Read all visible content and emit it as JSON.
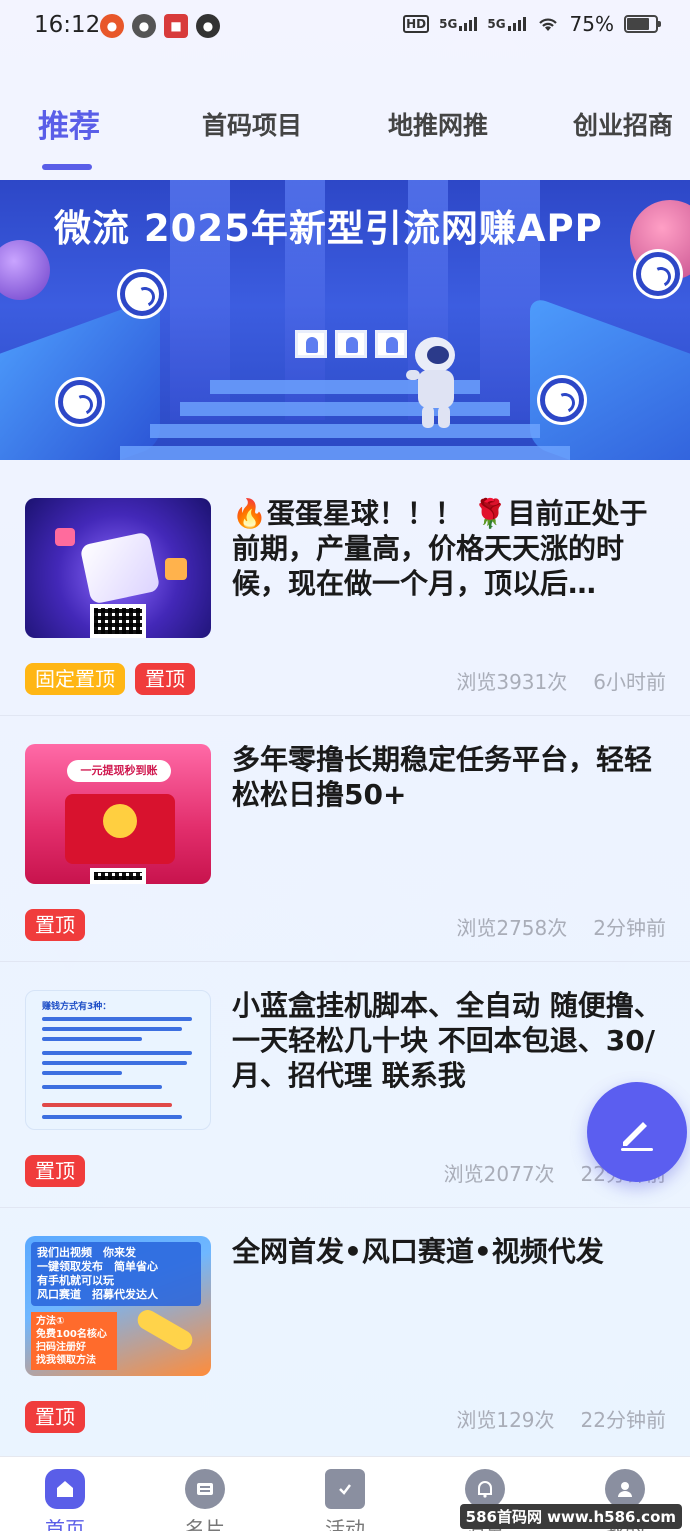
{
  "status_bar": {
    "time": "16:12",
    "battery_percent": "75%",
    "hd_label": "HD",
    "net1": "5G",
    "net2": "5G",
    "battery_level": 0.75
  },
  "tabs": [
    {
      "label": "推荐",
      "active": true
    },
    {
      "label": "首码项目",
      "active": false
    },
    {
      "label": "地推网推",
      "active": false
    },
    {
      "label": "创业招商",
      "active": false
    }
  ],
  "banner": {
    "title": "微流 2025年新型引流网赚APP"
  },
  "posts": [
    {
      "title": "🔥蛋蛋星球！！！ 🌹目前正处于前期，产量高，价格天天涨的时候，现在做一个月，顶以后…",
      "badges": [
        {
          "label": "固定置顶",
          "color": "yellow"
        },
        {
          "label": "置顶",
          "color": "red"
        }
      ],
      "views": "浏览3931次",
      "time": "6小时前"
    },
    {
      "title": "多年零撸长期稳定任务平台，轻轻松松日撸50+",
      "badges": [
        {
          "label": "置顶",
          "color": "red"
        }
      ],
      "views": "浏览2758次",
      "time": "2分钟前",
      "thumb_text": "一元提现秒到账"
    },
    {
      "title": "小蓝盒挂机脚本、全自动 随便撸、一天轻松几十块 不回本包退、30/月、招代理 联系我",
      "badges": [
        {
          "label": "置顶",
          "color": "red"
        }
      ],
      "views": "浏览2077次",
      "time": "22分钟前",
      "thumb_text": "赚钱方式有3种："
    },
    {
      "title": "全网首发•风口赛道•视频代发",
      "badges": [
        {
          "label": "置顶",
          "color": "red"
        }
      ],
      "views": "浏览129次",
      "time": "22分钟前",
      "thumb_lines": [
        "我们出视频　你来发",
        "一键领取发布　简单省心",
        "有手机就可以玩",
        "风口赛道　招募代发达人"
      ],
      "thumb_method": "方法①",
      "thumb_method_lines": [
        "免费100名核心",
        "扫码注册好",
        "找我领取方法"
      ]
    }
  ],
  "bottom_nav": [
    {
      "label": "首页",
      "icon": "home-icon",
      "active": true
    },
    {
      "label": "名片",
      "icon": "card-icon",
      "active": false
    },
    {
      "label": "活动",
      "icon": "task-icon",
      "active": false
    },
    {
      "label": "消息",
      "icon": "bell-icon",
      "active": false
    },
    {
      "label": "我的",
      "icon": "user-icon",
      "active": false
    }
  ],
  "watermark": "586首码网 www.h586.com",
  "colors": {
    "accent": "#5a5ee8",
    "badge_red": "#f03c3c",
    "badge_yellow": "#ffb615",
    "meta_gray": "#a9adb8"
  }
}
